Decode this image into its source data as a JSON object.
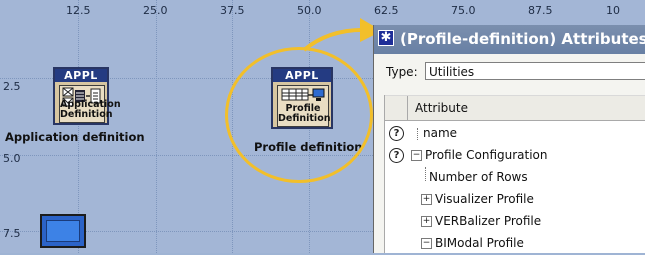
{
  "canvas": {
    "x_ticks": [
      "12.5",
      "25.0",
      "37.5",
      "50.0",
      "62.5",
      "75.0",
      "87.5",
      "10"
    ],
    "y_ticks": [
      "2.5",
      "5.0",
      "7.5"
    ]
  },
  "nodes": {
    "application": {
      "header": "APPL",
      "subtitle_line1": "Application",
      "subtitle_line2": "Definition",
      "label": "Application definition"
    },
    "profile": {
      "header": "APPL",
      "subtitle_line1": "Profile",
      "subtitle_line2": "Definition",
      "label": "Profile definition"
    }
  },
  "attributes_window": {
    "title": "(Profile-definition) Attributes",
    "type_label": "Type:",
    "type_value": "Utilities",
    "column_header": "Attribute",
    "rows": [
      {
        "label": "name"
      },
      {
        "label": "Profile Configuration"
      },
      {
        "label": "Number of Rows"
      },
      {
        "label": "Visualizer Profile"
      },
      {
        "label": "VERBalizer Profile"
      },
      {
        "label": "BIModal Profile"
      }
    ]
  },
  "colors": {
    "canvas": "#a3b6d6",
    "node_header": "#243b82",
    "highlight": "#f2bf2a",
    "titlebar": "#6e86aa"
  }
}
